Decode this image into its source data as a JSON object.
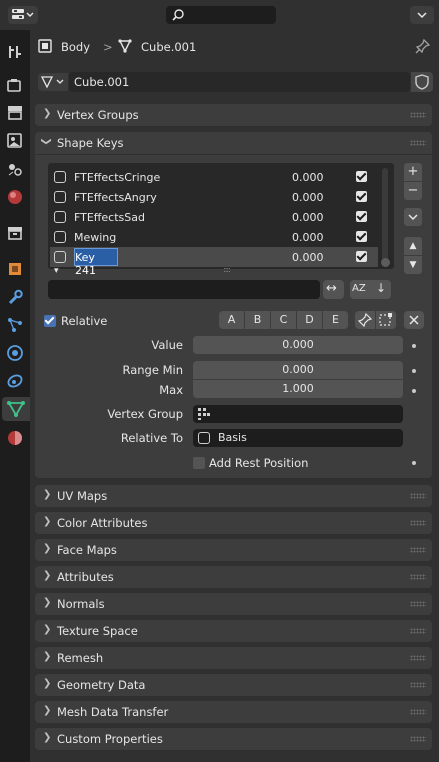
{
  "header": {
    "editor_type_icon": "properties-editor-icon",
    "search_icon": "search-icon",
    "menu_icon": "chevron-down-icon"
  },
  "tabs": [
    {
      "name": "tool-tab-icon"
    },
    {
      "name": "render-tab-icon"
    },
    {
      "name": "output-tab-icon"
    },
    {
      "name": "view-layer-tab-icon"
    },
    {
      "name": "scene-tab-icon"
    },
    {
      "name": "world-tab-icon"
    },
    {
      "name": "collection-tab-icon"
    },
    {
      "name": "object-tab-icon"
    },
    {
      "name": "modifiers-tab-icon"
    },
    {
      "name": "particles-tab-icon"
    },
    {
      "name": "physics-tab-icon"
    },
    {
      "name": "constraints-tab-icon"
    },
    {
      "name": "data-tab-icon"
    },
    {
      "name": "material-tab-icon"
    }
  ],
  "breadcrumb": {
    "object": "Body",
    "separator": ">",
    "mesh": "Cube.001"
  },
  "datablock": {
    "name": "Cube.001"
  },
  "panels": {
    "vertex_groups": "Vertex Groups",
    "shape_keys": "Shape Keys",
    "uv_maps": "UV Maps",
    "color_attributes": "Color Attributes",
    "face_maps": "Face Maps",
    "attributes": "Attributes",
    "normals": "Normals",
    "texture_space": "Texture Space",
    "remesh": "Remesh",
    "geometry_data": "Geometry Data",
    "mesh_data_transfer": "Mesh Data Transfer",
    "custom_properties": "Custom Properties"
  },
  "shape_keys": {
    "list": [
      {
        "name": "FTEffectsCringe",
        "value": "0.000",
        "checked": true
      },
      {
        "name": "FTEffectsAngry",
        "value": "0.000",
        "checked": true
      },
      {
        "name": "FTEffectsSad",
        "value": "0.000",
        "checked": true
      },
      {
        "name": "Mewing",
        "value": "0.000",
        "checked": true
      },
      {
        "name": "Key 241",
        "value": "0.000",
        "checked": true,
        "selected": true
      }
    ],
    "side_buttons": {
      "add": "+",
      "remove": "−",
      "specials": "⌄",
      "move_up": "▲",
      "move_down": "▼"
    },
    "filter_placeholder": "",
    "sort_alpha": "AZ",
    "sort_reverse": "↓",
    "filter_toggle": "↔",
    "expand_marker": "▾",
    "resize_grip": "::::",
    "relative_label": "Relative",
    "letters": [
      "A",
      "B",
      "C",
      "D",
      "E"
    ],
    "value_label": "Value",
    "value": "0.000",
    "range_min_label": "Range Min",
    "range_min": "0.000",
    "max_label": "Max",
    "max": "1.000",
    "vertex_group_label": "Vertex Group",
    "vertex_group": "",
    "relative_to_label": "Relative To",
    "relative_to": "Basis",
    "add_rest_label": "Add Rest Position"
  },
  "colors": {
    "accent": "#4772b3",
    "selection": "#2b5fa5"
  }
}
